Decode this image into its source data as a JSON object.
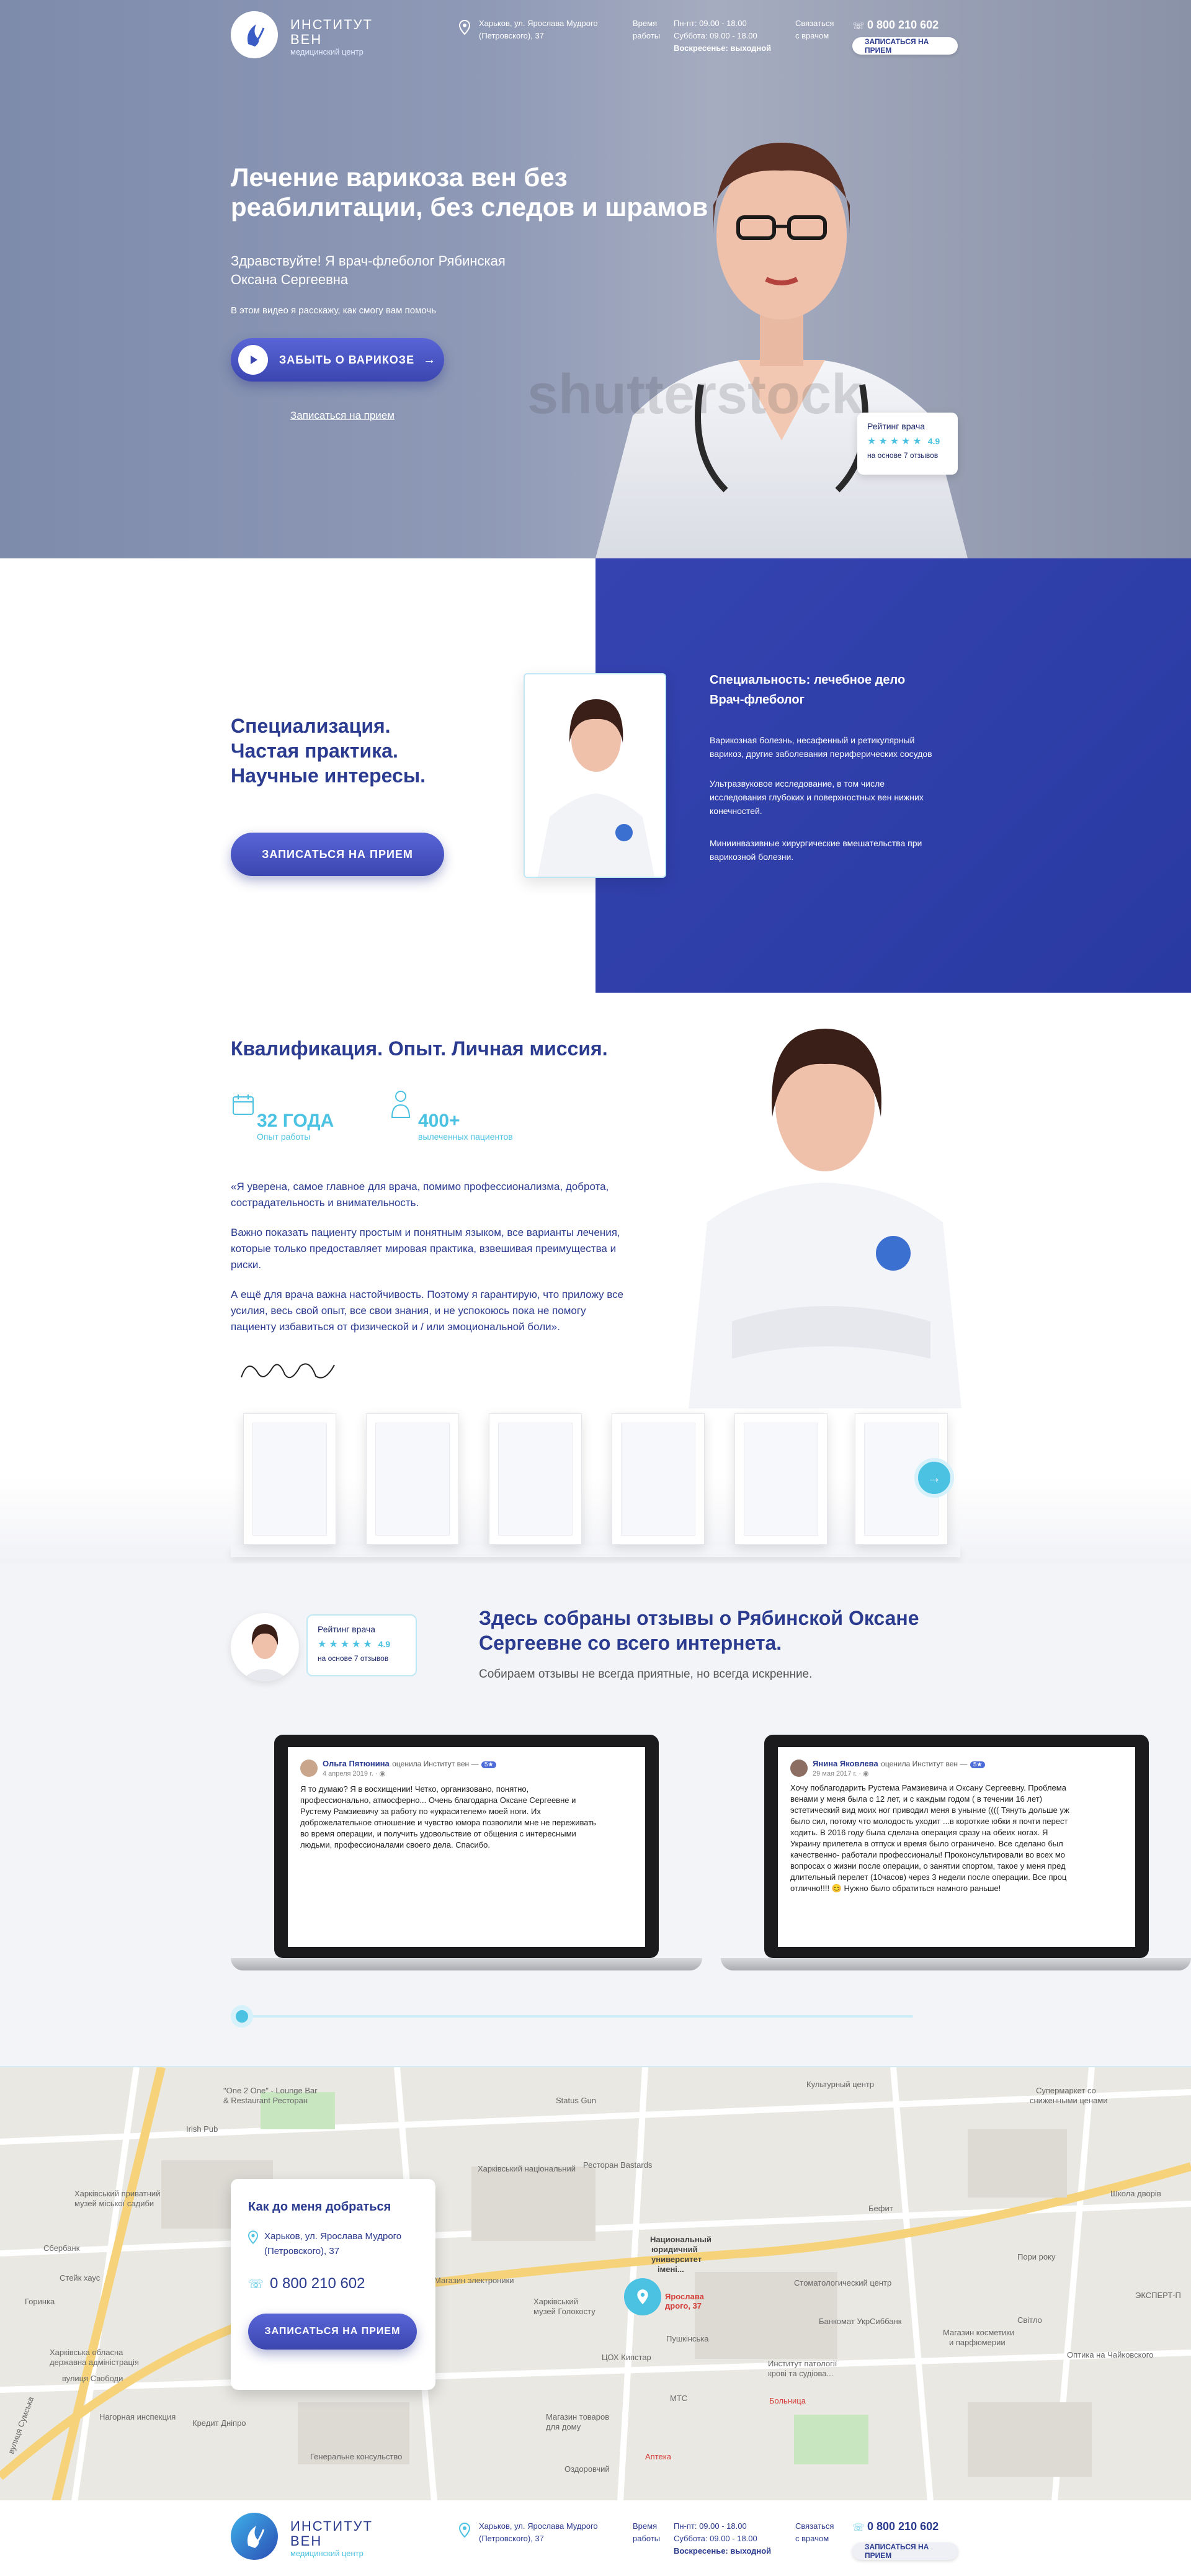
{
  "header": {
    "logo_name_1": "ИНСТИТУТ",
    "logo_name_2": "ВЕН",
    "logo_sub": "медицинский центр",
    "address_1": "Харьков, ул. Ярослава Мудрого",
    "address_2": "(Петровского), 37",
    "hours_label_1": "Время",
    "hours_label_2": "работы",
    "hours_1": "Пн-пт: 09.00 - 18.00",
    "hours_2": "Суббота: 09.00 - 18.00",
    "hours_3": "Воскресенье: выходной",
    "contact_label_1": "Связаться",
    "contact_label_2": "с врачом",
    "phone": "0 800 210 602",
    "appointment_btn": "ЗАПИСАТЬСЯ НА ПРИЕМ"
  },
  "hero": {
    "title_1": "Лечение варикоза вен без",
    "title_2": "реабилитации, без следов и шрамов",
    "greeting_1": "Здравствуйте! Я врач-флеболог Рябинская",
    "greeting_2": "Оксана Сергеевна",
    "video_hint": "В этом видео я расскажу, как смогу вам помочь",
    "video_btn": "ЗАБЫТЬ О ВАРИКОЗЕ",
    "appointment_link": "Записаться на прием",
    "watermark": "shutterstock",
    "rating": {
      "title": "Рейтинг врача",
      "stars": "★★★★★",
      "value": "4.9",
      "sub": "на основе 7 отзывов"
    }
  },
  "spec": {
    "heading_1": "Специализация.",
    "heading_2": "Частая практика.",
    "heading_3": "Научные интересы.",
    "btn": "ЗАПИСАТЬСЯ НА ПРИЕМ",
    "title_1": "Специальность: лечебное дело",
    "title_2": "Врач-флеболог",
    "p1_1": "Варикозная болезнь, несафенный и ретикулярный",
    "p1_2": "варикоз, другие заболевания периферических сосудов",
    "p2_1": "Ультразвуковое исследование, в том числе",
    "p2_2": "исследования глубоких и поверхностных вен нижних",
    "p2_3": "конечностей.",
    "p3_1": "Миниинвазивные хирургические вмешательства при",
    "p3_2": "варикозной болезни."
  },
  "qualif": {
    "heading": "Квалификация. Опыт. Личная миссия.",
    "stat1_num": "32 ГОДА",
    "stat1_lbl": "Опыт работы",
    "stat2_num": "400+",
    "stat2_lbl": "вылеченных пациентов",
    "q1_1": "«Я уверена, самое главное для врача, помимо профессионализма, доброта,",
    "q1_2": "сострадательность и внимательность.",
    "q2_1": "Важно показать пациенту простым и понятным языком, все варианты лечения,",
    "q2_2": "которые только предоставляет мировая практика, взвешивая преимущества и",
    "q2_3": "риски.",
    "q3_1": "А ещё для врача важна настойчивость. Поэтому я гарантирую, что приложу все",
    "q3_2": "усилия, весь свой опыт, все свои знания, и не успокоюсь пока не помогу",
    "q3_3": "пациенту избавиться от физической и / или эмоциональной боли».",
    "signature": "Ryabinska"
  },
  "reviews": {
    "heading_1": "Здесь собраны отзывы о Рябинской Оксане",
    "heading_2": "Сергеевне со всего интернета.",
    "sub": "Собираем отзывы не всегда приятные, но всегда искренние.",
    "rating": {
      "title": "Рейтинг врача",
      "stars": "★★★★★",
      "value": "4.9",
      "sub": "на основе 7 отзывов"
    },
    "items": [
      {
        "name": "Ольга Пятюнина",
        "action": "оценила Институт вен —",
        "badge": "5★",
        "date": "4 апреля 2019 г. · ◉",
        "lines": [
          "Я то думаю? Я в восхищении! Четко, организовано, понятно,",
          "профессионально, атмосферно... Очень благодарна Оксане Сергеевне и",
          "Рустему Рамзиевичу за работу по «украсителем» моей ноги. Их",
          "доброжелательное отношение и чувство юмора позволили мне не переживать",
          "во время операции, и получить удовольствие от общения с интересными",
          "людьми, профессионалами своего дела. Спасибо."
        ]
      },
      {
        "name": "Янина Яковлева",
        "action": "оценила Институт вен —",
        "badge": "5★",
        "date": "29 мая 2017 г. · ◉",
        "lines": [
          "Хочу поблагодарить Рустема Рамзиевича и Оксану Сергеевну. Проблема",
          "венами у меня была с 12 лет, и с каждым годом ( в течении 16 лет)",
          "эстетический вид моих ног приводил меня в уныние (((( Тянуть дольше уж",
          "было сил, потому что молодость уходит ...в короткие юбки я почти перест",
          "ходить. В 2016 году была сделана операция сразу на обеих ногах. Я",
          "Украину прилетела в отпуск и время было ограничено. Все сделано был",
          "качественно- работали профессионалы! Проконсультировали во всех мо",
          "вопросах о жизни после операции, о занятии спортом, такое у меня пред",
          "длительный перелет (10часов) через 3 недели после операции. Все проц",
          "отлично!!!! 😊 Нужно было обратиться намного раньше!"
        ]
      }
    ]
  },
  "map": {
    "card_title": "Как до меня добраться",
    "address_1": "Харьков, ул. Ярослава Мудрого",
    "address_2": "(Петровского), 37",
    "phone": "0 800 210 602",
    "btn": "ЗАПИСАТЬСЯ НА ПРИЕМ",
    "pin_label_1": "Ярослава",
    "pin_label_2": "дрого, 37",
    "labels": [
      "\"One 2 One\" - Lounge Bar",
      "& Restaurant Ресторан",
      "Irish Pub",
      "Харківський приватний",
      "музей міської садиби",
      "Сбербанк",
      "Стейк хаус",
      "Горинка",
      "Харківська обласна",
      "державна адміністрація",
      "Status Gun",
      "Харківський національний",
      "Ресторан Bastards",
      "Культурный центр",
      "Супермаркет со",
      "сниженными ценами",
      "Национальный",
      "юридичний",
      "университет",
      "імені...",
      "Харківський",
      "музей Голокосту",
      "Пушкінська",
      "ЦОХ Кипстар",
      "Институт патології",
      "крові та судіова...",
      "Магазин электроники",
      "Нагорная инспекция",
      "Кредит Дніпро",
      "Генеральне консульство",
      "Оздоровчий",
      "Аптека",
      "МТС",
      "Больница",
      "Магазин косметики",
      "и парфюмерии",
      "Банкомат УкрСиббанк",
      "Стоматологический центр",
      "Школа дворів",
      "Пори року",
      "ЭКСПЕРТ-П",
      "Оптика на Чайковского",
      "Бефит",
      "Світло",
      "Магазин товаров",
      "для дому",
      "вулиця Свободи",
      "вулиця Сумська"
    ]
  },
  "footer": {
    "logo_name_1": "ИНСТИТУТ",
    "logo_name_2": "ВЕН",
    "logo_sub": "медицинский центр",
    "address_1": "Харьков, ул. Ярослава Мудрого",
    "address_2": "(Петровского), 37",
    "hours_label_1": "Время",
    "hours_label_2": "работы",
    "hours_1": "Пн-пт: 09.00 - 18.00",
    "hours_2": "Суббота: 09.00 - 18.00",
    "hours_3": "Воскресенье: выходной",
    "contact_label_1": "Связаться",
    "contact_label_2": "с врачом",
    "phone": "0 800 210 602",
    "appointment_btn": "ЗАПИСАТЬСЯ НА ПРИЕМ"
  },
  "colors": {
    "navy": "#2b3b8f",
    "accent": "#4cc2e3",
    "spec_bg": "#3443b0"
  }
}
